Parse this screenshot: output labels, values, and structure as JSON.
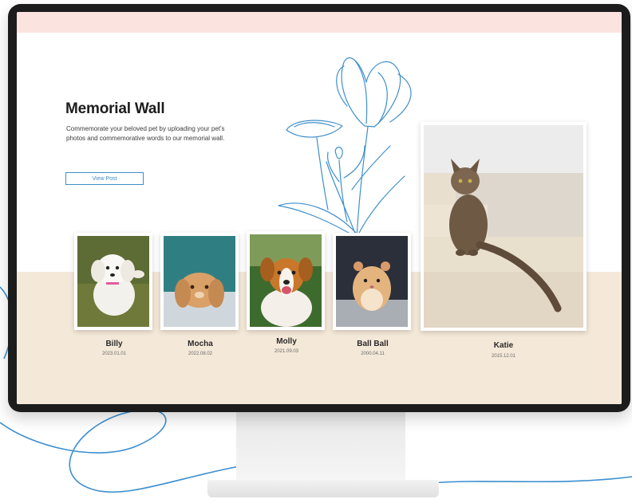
{
  "memorial": {
    "title": "Memorial Wall",
    "description": "Commemorate your beloved pet by uploading your pet's photos and commemorative words to our memorial wall.",
    "button_label": "View Post"
  },
  "pets": [
    {
      "name": "Billy",
      "date": "2023.01.01"
    },
    {
      "name": "Mocha",
      "date": "2022.08.02"
    },
    {
      "name": "Molly",
      "date": "2021.09.03"
    },
    {
      "name": "Ball Ball",
      "date": "2000.04.11"
    },
    {
      "name": "Katie",
      "date": "2015.12.01"
    }
  ],
  "colors": {
    "accent": "#3d8ec9",
    "top_bar": "#fbe3df",
    "bottom_band": "#f4e8d8",
    "bezel": "#1c1c1c"
  }
}
